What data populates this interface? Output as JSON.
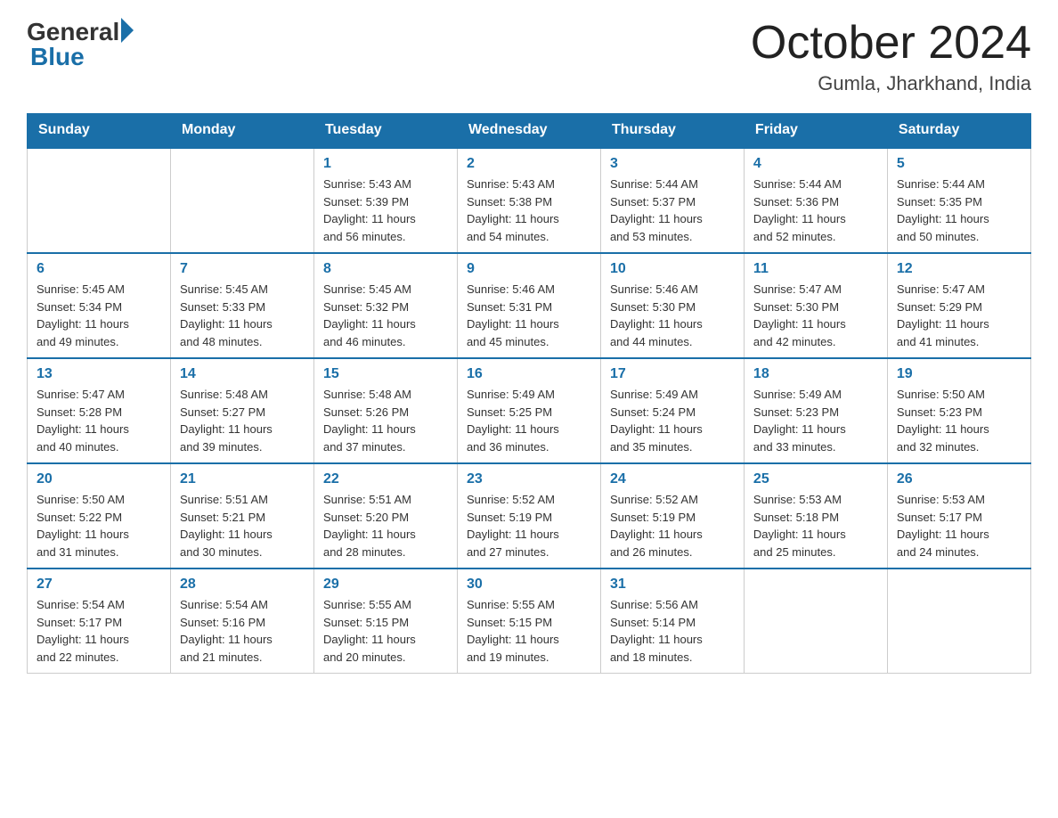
{
  "header": {
    "logo_general": "General",
    "logo_blue": "Blue",
    "month_title": "October 2024",
    "location": "Gumla, Jharkhand, India"
  },
  "days_of_week": [
    "Sunday",
    "Monday",
    "Tuesday",
    "Wednesday",
    "Thursday",
    "Friday",
    "Saturday"
  ],
  "weeks": [
    [
      {
        "day": "",
        "info": ""
      },
      {
        "day": "",
        "info": ""
      },
      {
        "day": "1",
        "info": "Sunrise: 5:43 AM\nSunset: 5:39 PM\nDaylight: 11 hours\nand 56 minutes."
      },
      {
        "day": "2",
        "info": "Sunrise: 5:43 AM\nSunset: 5:38 PM\nDaylight: 11 hours\nand 54 minutes."
      },
      {
        "day": "3",
        "info": "Sunrise: 5:44 AM\nSunset: 5:37 PM\nDaylight: 11 hours\nand 53 minutes."
      },
      {
        "day": "4",
        "info": "Sunrise: 5:44 AM\nSunset: 5:36 PM\nDaylight: 11 hours\nand 52 minutes."
      },
      {
        "day": "5",
        "info": "Sunrise: 5:44 AM\nSunset: 5:35 PM\nDaylight: 11 hours\nand 50 minutes."
      }
    ],
    [
      {
        "day": "6",
        "info": "Sunrise: 5:45 AM\nSunset: 5:34 PM\nDaylight: 11 hours\nand 49 minutes."
      },
      {
        "day": "7",
        "info": "Sunrise: 5:45 AM\nSunset: 5:33 PM\nDaylight: 11 hours\nand 48 minutes."
      },
      {
        "day": "8",
        "info": "Sunrise: 5:45 AM\nSunset: 5:32 PM\nDaylight: 11 hours\nand 46 minutes."
      },
      {
        "day": "9",
        "info": "Sunrise: 5:46 AM\nSunset: 5:31 PM\nDaylight: 11 hours\nand 45 minutes."
      },
      {
        "day": "10",
        "info": "Sunrise: 5:46 AM\nSunset: 5:30 PM\nDaylight: 11 hours\nand 44 minutes."
      },
      {
        "day": "11",
        "info": "Sunrise: 5:47 AM\nSunset: 5:30 PM\nDaylight: 11 hours\nand 42 minutes."
      },
      {
        "day": "12",
        "info": "Sunrise: 5:47 AM\nSunset: 5:29 PM\nDaylight: 11 hours\nand 41 minutes."
      }
    ],
    [
      {
        "day": "13",
        "info": "Sunrise: 5:47 AM\nSunset: 5:28 PM\nDaylight: 11 hours\nand 40 minutes."
      },
      {
        "day": "14",
        "info": "Sunrise: 5:48 AM\nSunset: 5:27 PM\nDaylight: 11 hours\nand 39 minutes."
      },
      {
        "day": "15",
        "info": "Sunrise: 5:48 AM\nSunset: 5:26 PM\nDaylight: 11 hours\nand 37 minutes."
      },
      {
        "day": "16",
        "info": "Sunrise: 5:49 AM\nSunset: 5:25 PM\nDaylight: 11 hours\nand 36 minutes."
      },
      {
        "day": "17",
        "info": "Sunrise: 5:49 AM\nSunset: 5:24 PM\nDaylight: 11 hours\nand 35 minutes."
      },
      {
        "day": "18",
        "info": "Sunrise: 5:49 AM\nSunset: 5:23 PM\nDaylight: 11 hours\nand 33 minutes."
      },
      {
        "day": "19",
        "info": "Sunrise: 5:50 AM\nSunset: 5:23 PM\nDaylight: 11 hours\nand 32 minutes."
      }
    ],
    [
      {
        "day": "20",
        "info": "Sunrise: 5:50 AM\nSunset: 5:22 PM\nDaylight: 11 hours\nand 31 minutes."
      },
      {
        "day": "21",
        "info": "Sunrise: 5:51 AM\nSunset: 5:21 PM\nDaylight: 11 hours\nand 30 minutes."
      },
      {
        "day": "22",
        "info": "Sunrise: 5:51 AM\nSunset: 5:20 PM\nDaylight: 11 hours\nand 28 minutes."
      },
      {
        "day": "23",
        "info": "Sunrise: 5:52 AM\nSunset: 5:19 PM\nDaylight: 11 hours\nand 27 minutes."
      },
      {
        "day": "24",
        "info": "Sunrise: 5:52 AM\nSunset: 5:19 PM\nDaylight: 11 hours\nand 26 minutes."
      },
      {
        "day": "25",
        "info": "Sunrise: 5:53 AM\nSunset: 5:18 PM\nDaylight: 11 hours\nand 25 minutes."
      },
      {
        "day": "26",
        "info": "Sunrise: 5:53 AM\nSunset: 5:17 PM\nDaylight: 11 hours\nand 24 minutes."
      }
    ],
    [
      {
        "day": "27",
        "info": "Sunrise: 5:54 AM\nSunset: 5:17 PM\nDaylight: 11 hours\nand 22 minutes."
      },
      {
        "day": "28",
        "info": "Sunrise: 5:54 AM\nSunset: 5:16 PM\nDaylight: 11 hours\nand 21 minutes."
      },
      {
        "day": "29",
        "info": "Sunrise: 5:55 AM\nSunset: 5:15 PM\nDaylight: 11 hours\nand 20 minutes."
      },
      {
        "day": "30",
        "info": "Sunrise: 5:55 AM\nSunset: 5:15 PM\nDaylight: 11 hours\nand 19 minutes."
      },
      {
        "day": "31",
        "info": "Sunrise: 5:56 AM\nSunset: 5:14 PM\nDaylight: 11 hours\nand 18 minutes."
      },
      {
        "day": "",
        "info": ""
      },
      {
        "day": "",
        "info": ""
      }
    ]
  ]
}
